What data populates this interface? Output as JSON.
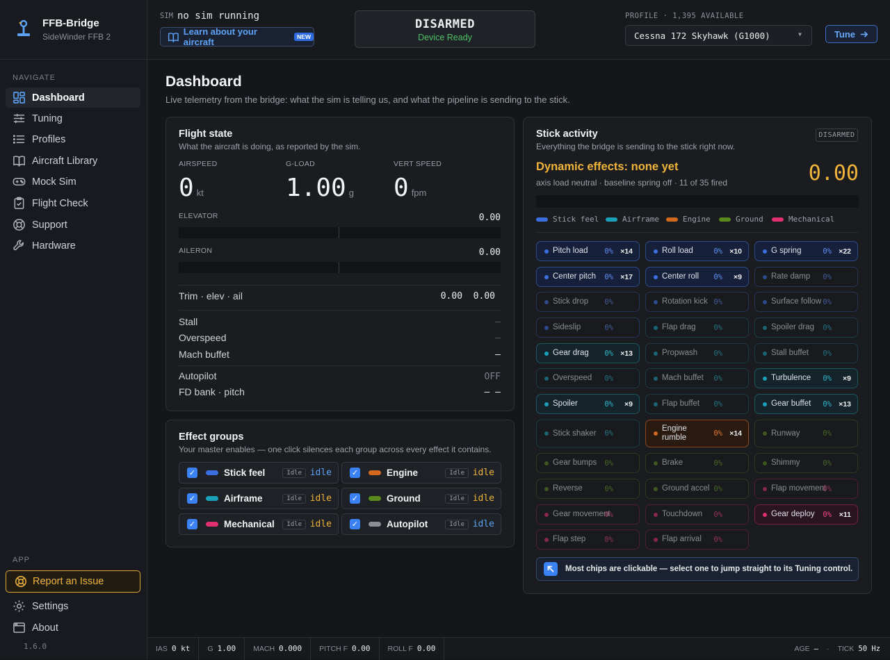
{
  "app": {
    "name": "FFB-Bridge",
    "device": "SideWinder FFB 2",
    "version": "1.6.0"
  },
  "nav": {
    "heading": "NAVIGATE",
    "items": [
      {
        "label": "Dashboard",
        "icon": "dashboard-icon",
        "active": true
      },
      {
        "label": "Tuning",
        "icon": "sliders-icon"
      },
      {
        "label": "Profiles",
        "icon": "list-icon"
      },
      {
        "label": "Aircraft Library",
        "icon": "book-icon"
      },
      {
        "label": "Mock Sim",
        "icon": "gamepad-icon"
      },
      {
        "label": "Flight Check",
        "icon": "clipboard-icon"
      },
      {
        "label": "Support",
        "icon": "lifebuoy-icon"
      },
      {
        "label": "Hardware",
        "icon": "wrench-icon"
      }
    ],
    "app_heading": "APP",
    "report": "Report an Issue",
    "settings": "Settings",
    "about": "About"
  },
  "topbar": {
    "sim_label": "SIM",
    "sim_value": "no sim running",
    "learn": "Learn about your aircraft",
    "learn_badge": "NEW",
    "arm_state": "DISARMED",
    "arm_sub": "Device Ready",
    "profile_label": "PROFILE · 1,395 AVAILABLE",
    "profile_value": "Cessna 172 Skyhawk (G1000)",
    "tune": "Tune"
  },
  "page": {
    "title": "Dashboard",
    "subtitle": "Live telemetry from the bridge: what the sim is telling us, and what the pipeline is sending to the stick."
  },
  "flight_state": {
    "title": "Flight state",
    "subtitle": "What the aircraft is doing, as reported by the sim.",
    "airspeed": {
      "label": "AIRSPEED",
      "value": "0",
      "unit": "kt"
    },
    "gload": {
      "label": "G-LOAD",
      "value": "1.00",
      "unit": "g"
    },
    "vspeed": {
      "label": "VERT SPEED",
      "value": "0",
      "unit": "fpm"
    },
    "elevator": {
      "label": "ELEVATOR",
      "value": "0.00"
    },
    "aileron": {
      "label": "AILERON",
      "value": "0.00"
    },
    "trim": {
      "label": "Trim · elev · ail",
      "value": "0.00  0.00"
    },
    "stall": {
      "label": "Stall",
      "value": "–"
    },
    "overspeed": {
      "label": "Overspeed",
      "value": "–"
    },
    "mach": {
      "label": "Mach buffet",
      "value": "–"
    },
    "autopilot": {
      "label": "Autopilot",
      "value": "OFF"
    },
    "fd": {
      "label": "FD bank · pitch",
      "value": "– –"
    }
  },
  "effect_groups": {
    "title": "Effect groups",
    "subtitle": "Your master enables — one click silences each group across every effect it contains.",
    "idle_tag": "Idle",
    "items": [
      {
        "name": "Stick feel",
        "color": "#3b6fe0",
        "state": "idle",
        "state_color": "#5ea2f7"
      },
      {
        "name": "Engine",
        "color": "#d2691e",
        "state": "idle",
        "state_color": "#f0b43a"
      },
      {
        "name": "Airframe",
        "color": "#1aa0b8",
        "state": "idle",
        "state_color": "#f0b43a"
      },
      {
        "name": "Ground",
        "color": "#5a8a1e",
        "state": "idle",
        "state_color": "#f0b43a"
      },
      {
        "name": "Mechanical",
        "color": "#e0306e",
        "state": "idle",
        "state_color": "#f0b43a"
      },
      {
        "name": "Autopilot",
        "color": "#8b8e94",
        "state": "idle",
        "state_color": "#5ea2f7"
      }
    ]
  },
  "stick": {
    "title": "Stick activity",
    "subtitle": "Everything the bridge is sending to the stick right now.",
    "badge": "DISARMED",
    "dynamic_title": "Dynamic effects: none yet",
    "dynamic_sub": "axis load neutral · baseline spring off · 11 of 35 fired",
    "dynamic_value": "0.00",
    "legend": [
      {
        "name": "Stick feel",
        "color": "#3b6fe0"
      },
      {
        "name": "Airframe",
        "color": "#1aa0b8"
      },
      {
        "name": "Engine",
        "color": "#d2691e"
      },
      {
        "name": "Ground",
        "color": "#5a8a1e"
      },
      {
        "name": "Mechanical",
        "color": "#e0306e"
      }
    ],
    "chips": [
      {
        "label": "Pitch load",
        "group": "stick",
        "pct": "0%",
        "count": "×14"
      },
      {
        "label": "Roll load",
        "group": "stick",
        "pct": "0%",
        "count": "×10"
      },
      {
        "label": "G spring",
        "group": "stick",
        "pct": "0%",
        "count": "×22"
      },
      {
        "label": "Center pitch",
        "group": "stick",
        "pct": "0%",
        "count": "×17"
      },
      {
        "label": "Center roll",
        "group": "stick",
        "pct": "0%",
        "count": "×9"
      },
      {
        "label": "Rate damp",
        "group": "stick",
        "pct": "0%",
        "count": ""
      },
      {
        "label": "Stick drop",
        "group": "stick",
        "pct": "0%",
        "count": ""
      },
      {
        "label": "Rotation kick",
        "group": "stick",
        "pct": "0%",
        "count": ""
      },
      {
        "label": "Surface follow",
        "group": "stick",
        "pct": "0%",
        "count": ""
      },
      {
        "label": "Sideslip",
        "group": "stick",
        "pct": "0%",
        "count": ""
      },
      {
        "label": "Flap drag",
        "group": "air",
        "pct": "0%",
        "count": ""
      },
      {
        "label": "Spoiler drag",
        "group": "air",
        "pct": "0%",
        "count": ""
      },
      {
        "label": "Gear drag",
        "group": "air",
        "pct": "0%",
        "count": "×13"
      },
      {
        "label": "Propwash",
        "group": "air",
        "pct": "0%",
        "count": ""
      },
      {
        "label": "Stall buffet",
        "group": "air",
        "pct": "0%",
        "count": ""
      },
      {
        "label": "Overspeed",
        "group": "air",
        "pct": "0%",
        "count": ""
      },
      {
        "label": "Mach buffet",
        "group": "air",
        "pct": "0%",
        "count": ""
      },
      {
        "label": "Turbulence",
        "group": "air",
        "pct": "0%",
        "count": "×9"
      },
      {
        "label": "Spoiler",
        "group": "air",
        "pct": "0%",
        "count": "×9"
      },
      {
        "label": "Flap buffet",
        "group": "air",
        "pct": "0%",
        "count": ""
      },
      {
        "label": "Gear buffet",
        "group": "air",
        "pct": "0%",
        "count": "×13"
      },
      {
        "label": "Stick shaker",
        "group": "air",
        "pct": "0%",
        "count": ""
      },
      {
        "label": "Engine rumble",
        "group": "engine",
        "pct": "0%",
        "count": "×14"
      },
      {
        "label": "Runway",
        "group": "ground",
        "pct": "0%",
        "count": ""
      },
      {
        "label": "Gear bumps",
        "group": "ground",
        "pct": "0%",
        "count": ""
      },
      {
        "label": "Brake",
        "group": "ground",
        "pct": "0%",
        "count": ""
      },
      {
        "label": "Shimmy",
        "group": "ground",
        "pct": "0%",
        "count": ""
      },
      {
        "label": "Reverse",
        "group": "ground",
        "pct": "0%",
        "count": ""
      },
      {
        "label": "Ground accel",
        "group": "ground",
        "pct": "0%",
        "count": ""
      },
      {
        "label": "Flap movement",
        "group": "mech",
        "pct": "0%",
        "count": ""
      },
      {
        "label": "Gear movement",
        "group": "mech",
        "pct": "0%",
        "count": ""
      },
      {
        "label": "Touchdown",
        "group": "mech",
        "pct": "0%",
        "count": ""
      },
      {
        "label": "Gear deploy",
        "group": "mech",
        "pct": "0%",
        "count": "×11"
      },
      {
        "label": "Flap step",
        "group": "mech",
        "pct": "0%",
        "count": ""
      },
      {
        "label": "Flap arrival",
        "group": "mech",
        "pct": "0%",
        "count": ""
      }
    ],
    "tip": "Most chips are clickable — select one to jump straight to its Tuning control."
  },
  "statusbar": {
    "ias_label": "IAS",
    "ias": "0 kt",
    "g_label": "G",
    "g": "1.00",
    "mach_label": "MACH",
    "mach": "0.000",
    "pitchf_label": "PITCH F",
    "pitchf": "0.00",
    "rollf_label": "ROLL F",
    "rollf": "0.00",
    "age_label": "AGE",
    "age": "—",
    "dot": "·",
    "tick_label": "TICK",
    "tick": "50 Hz"
  }
}
